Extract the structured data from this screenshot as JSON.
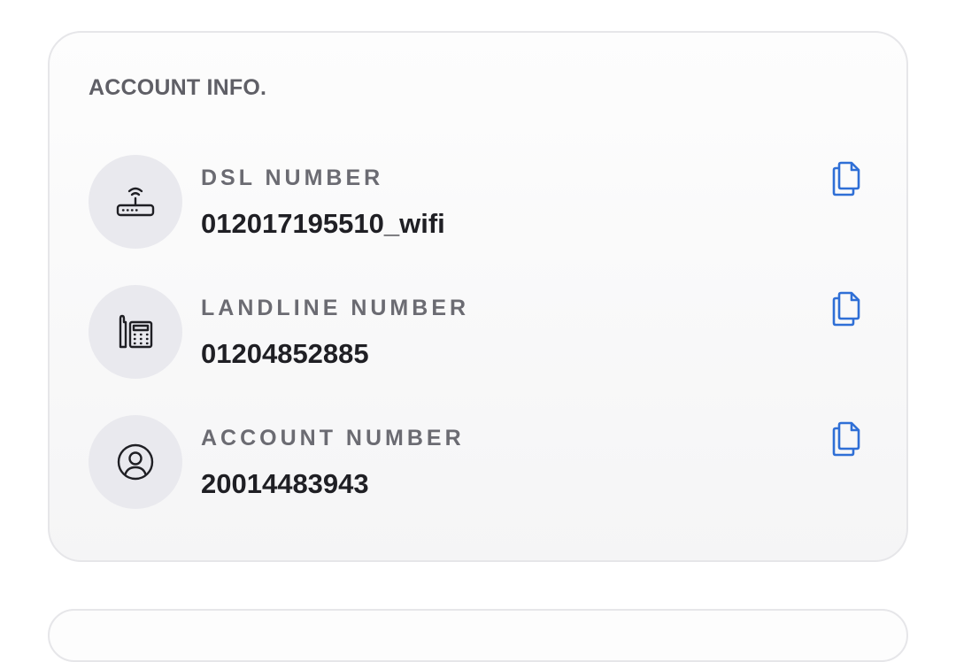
{
  "card": {
    "title": "ACCOUNT INFO."
  },
  "rows": [
    {
      "label": "DSL NUMBER",
      "value": "012017195510_wifi",
      "icon": "router-icon"
    },
    {
      "label": "LANDLINE NUMBER",
      "value": "01204852885",
      "icon": "landline-phone-icon"
    },
    {
      "label": "ACCOUNT NUMBER",
      "value": "20014483943",
      "icon": "user-circle-icon"
    }
  ],
  "colors": {
    "accent": "#2f6fd6",
    "icon_bg": "#e9e9ee",
    "label": "#6b6b72",
    "value": "#1f1f24"
  }
}
